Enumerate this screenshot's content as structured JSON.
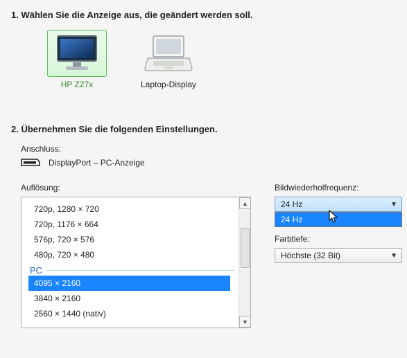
{
  "step1": {
    "heading": "1. Wählen Sie die Anzeige aus, die geändert werden soll."
  },
  "displays": {
    "0": {
      "label": "HP Z27x"
    },
    "1": {
      "label": "Laptop-Display"
    }
  },
  "step2": {
    "heading": "2. Übernehmen Sie die folgenden Einstellungen."
  },
  "connector": {
    "label": "Anschluss:",
    "value": "DisplayPort – PC-Anzeige"
  },
  "resolution": {
    "label": "Auflösung:",
    "group_pc": "PC",
    "items": {
      "0": "720p, 1280 × 720",
      "1": "720p, 1176 × 664",
      "2": "576p, 720 × 576",
      "3": "480p, 720 × 480",
      "4": "4095 × 2160",
      "5": "3840 × 2160",
      "6": "2560 × 1440 (nativ)"
    },
    "selected_index": 4
  },
  "refresh": {
    "label": "Bildwiederholfrequenz:",
    "current": "24 Hz",
    "options": {
      "0": "24 Hz"
    }
  },
  "colordepth": {
    "label": "Farbtiefe:",
    "current": "Höchste (32 Bit)"
  }
}
